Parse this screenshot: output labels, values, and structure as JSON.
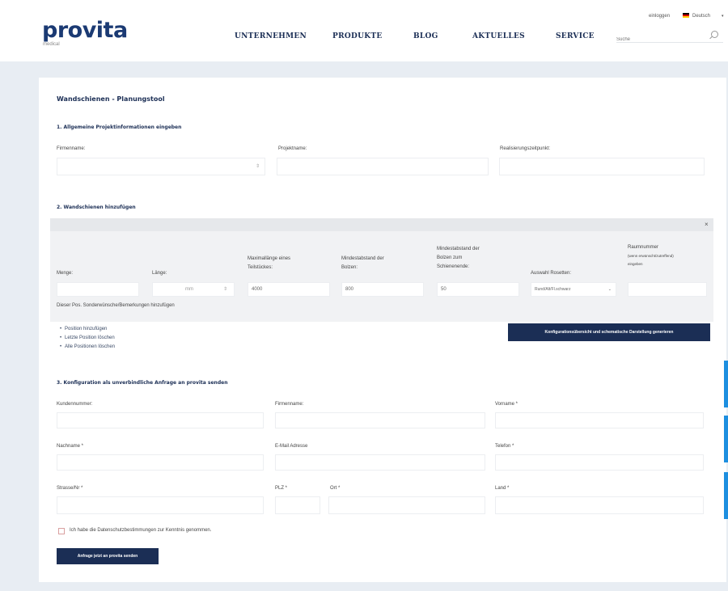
{
  "header": {
    "logo": "provita",
    "logo_sub": "medical",
    "nav": [
      "UNTERNEHMEN",
      "PRODUKTE",
      "BLOG",
      "AKTUELLES",
      "SERVICE"
    ],
    "login": "einloggen",
    "language": "Deutsch",
    "search_placeholder": "Suche"
  },
  "page": {
    "title": "Wandschienen - Planungstool",
    "section1": {
      "heading": "1. Allgemeine Projektinformationen eingeben",
      "labels": [
        "Firmenname:",
        "Projektname:",
        "Realisierungszeitpunkt:"
      ]
    },
    "section2": {
      "heading": "2. Wandschienen hinzufügen",
      "close": "×",
      "labels": {
        "menge": "Menge:",
        "laenge": "Länge:",
        "max_laenge": [
          "Maximallänge eines",
          "Teilstückes:"
        ],
        "mindest_bolzen": [
          "Mindestabstand der",
          "Bolzen:"
        ],
        "mindest_schiene": [
          "Mindestabstand der",
          "Bolzen zum",
          "Schienenende:"
        ],
        "rosetten": "Auswahl Rosetten:",
        "raum": "Raumnummer",
        "raum_hint": [
          "(wenn erwünscht/zutreffend)",
          "eingeben"
        ]
      },
      "values": {
        "laenge_unit": "mm",
        "max_laenge": "4000",
        "bolzen": "800",
        "schiene": "50",
        "rosette": "Rund/Alt/Fl.schwarz"
      },
      "note": "Dieser Pos. Sonderwünsche/Bemerkungen hinzufügen",
      "links": [
        "Position hinzufügen",
        "Letzte Position löschen",
        "Alle Positionen löschen"
      ],
      "generate_button": "Konfigurationsübersicht und schematische Darstellung generieren"
    },
    "section3": {
      "heading": "3. Konfiguration als unverbindliche Anfrage an provita senden",
      "labels": [
        "Kundennummer:",
        "Firmenname:",
        "Vorname *",
        "Nachname *",
        "E-Mail Adresse",
        "Telefon *",
        "Strasse/Nr *",
        "PLZ *",
        "Ort *",
        "Land *"
      ],
      "consent": "Ich habe die Datenschutzbestimmungen zur Kenntnis genommen.",
      "submit": "Anfrage jetzt an provita senden"
    }
  },
  "colors": {
    "brand": "#1b2e55",
    "accent": "#1d8fe0",
    "background": "#e8edf3"
  }
}
